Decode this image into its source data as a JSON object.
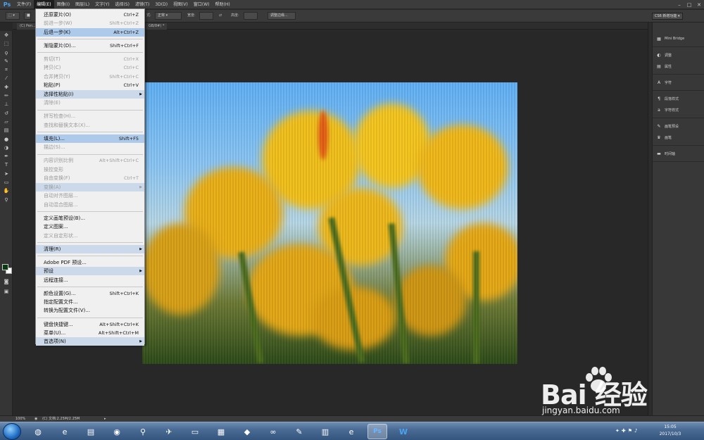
{
  "menubar": {
    "logo": "Ps",
    "items": [
      "文件(F)",
      "编辑(E)",
      "图像(I)",
      "图层(L)",
      "文字(Y)",
      "选择(S)",
      "滤镜(T)",
      "3D(D)",
      "视图(V)",
      "窗口(W)",
      "帮助(H)"
    ],
    "active_index": 1
  },
  "optionsbar": {
    "mode_label": "式:",
    "mode_value": "正常",
    "width_label": "宽度:",
    "height_label": "高度:",
    "refine_button": "调整边缘...",
    "workspace": "CS6 新增功能"
  },
  "tabs": [
    "(C) Pen...",
    "GB/8#) *"
  ],
  "edit_menu": [
    {
      "label": "还原蒙片(O)",
      "shortcut": "Ctrl+Z",
      "enabled": true
    },
    {
      "label": "前进一步(W)",
      "shortcut": "Shift+Ctrl+Z",
      "enabled": false
    },
    {
      "label": "后退一步(K)",
      "shortcut": "Alt+Ctrl+Z",
      "enabled": true,
      "highlight": true
    },
    {
      "sep": true
    },
    {
      "label": "渐隐蒙片(D)...",
      "shortcut": "Shift+Ctrl+F",
      "enabled": true
    },
    {
      "sep": true
    },
    {
      "label": "剪切(T)",
      "shortcut": "Ctrl+X",
      "enabled": false
    },
    {
      "label": "拷贝(C)",
      "shortcut": "Ctrl+C",
      "enabled": false
    },
    {
      "label": "合并拷贝(Y)",
      "shortcut": "Shift+Ctrl+C",
      "enabled": false
    },
    {
      "label": "粘贴(P)",
      "shortcut": "Ctrl+V",
      "enabled": true
    },
    {
      "label": "选择性粘贴(I)",
      "shortcut": "",
      "enabled": true,
      "submenu": true
    },
    {
      "label": "清除(E)",
      "shortcut": "",
      "enabled": false
    },
    {
      "sep": true
    },
    {
      "label": "拼写检查(H)...",
      "shortcut": "",
      "enabled": false
    },
    {
      "label": "查找和替换文本(X)...",
      "shortcut": "",
      "enabled": false
    },
    {
      "sep": true
    },
    {
      "label": "填充(L)...",
      "shortcut": "Shift+F5",
      "enabled": true,
      "highlight": true
    },
    {
      "label": "描边(S)...",
      "shortcut": "",
      "enabled": false
    },
    {
      "sep": true
    },
    {
      "label": "内容识别比例",
      "shortcut": "Alt+Shift+Ctrl+C",
      "enabled": false
    },
    {
      "label": "操控变形",
      "shortcut": "",
      "enabled": false
    },
    {
      "label": "自由变换(F)",
      "shortcut": "Ctrl+T",
      "enabled": false
    },
    {
      "label": "变换(A)",
      "shortcut": "",
      "enabled": false,
      "submenu": true
    },
    {
      "label": "自动对齐图层...",
      "shortcut": "",
      "enabled": false
    },
    {
      "label": "自动混合图层...",
      "shortcut": "",
      "enabled": false
    },
    {
      "sep": true
    },
    {
      "label": "定义画笔预设(B)...",
      "shortcut": "",
      "enabled": true
    },
    {
      "label": "定义图案...",
      "shortcut": "",
      "enabled": true
    },
    {
      "label": "定义自定形状...",
      "shortcut": "",
      "enabled": false
    },
    {
      "sep": true
    },
    {
      "label": "清理(R)",
      "shortcut": "",
      "enabled": true,
      "submenu": true
    },
    {
      "sep": true
    },
    {
      "label": "Adobe PDF 预设...",
      "shortcut": "",
      "enabled": true
    },
    {
      "label": "预设",
      "shortcut": "",
      "enabled": true,
      "submenu": true
    },
    {
      "label": "远程连接...",
      "shortcut": "",
      "enabled": true
    },
    {
      "sep": true
    },
    {
      "label": "颜色设置(G)...",
      "shortcut": "Shift+Ctrl+K",
      "enabled": true
    },
    {
      "label": "指定配置文件...",
      "shortcut": "",
      "enabled": true
    },
    {
      "label": "转换为配置文件(V)...",
      "shortcut": "",
      "enabled": true
    },
    {
      "sep": true
    },
    {
      "label": "键盘快捷键...",
      "shortcut": "Alt+Shift+Ctrl+K",
      "enabled": true
    },
    {
      "label": "菜单(U)...",
      "shortcut": "Alt+Shift+Ctrl+M",
      "enabled": true
    },
    {
      "label": "首选项(N)",
      "shortcut": "",
      "enabled": true,
      "submenu": true
    }
  ],
  "dock": {
    "groups": [
      [
        {
          "icon": "mini-bridge-icon",
          "label": "Mini Bridge"
        }
      ],
      [
        {
          "icon": "adjustments-icon",
          "label": "调整"
        },
        {
          "icon": "properties-icon",
          "label": "属性"
        }
      ],
      [
        {
          "icon": "character-icon",
          "label": "字符"
        }
      ],
      [
        {
          "icon": "paragraph-style-icon",
          "label": "段落样式"
        },
        {
          "icon": "character-style-icon",
          "label": "字符样式"
        }
      ],
      [
        {
          "icon": "brush-presets-icon",
          "label": "画笔预设"
        },
        {
          "icon": "brush-icon",
          "label": "画笔"
        }
      ],
      [
        {
          "icon": "timeline-icon",
          "label": "时间轴"
        }
      ]
    ]
  },
  "statusbar": {
    "zoom": "100%",
    "doc_info": "(C) 文档:2.25M/2.25M"
  },
  "taskbar": {
    "time": "15:05",
    "date": "2017/10/3"
  },
  "watermark": {
    "logo": "Bai  经验",
    "url": "jingyan.baidu.com"
  },
  "colors": {
    "menu_highlight": "#aecaea",
    "foreground": "#0a3a12",
    "background": "#ffffff"
  }
}
